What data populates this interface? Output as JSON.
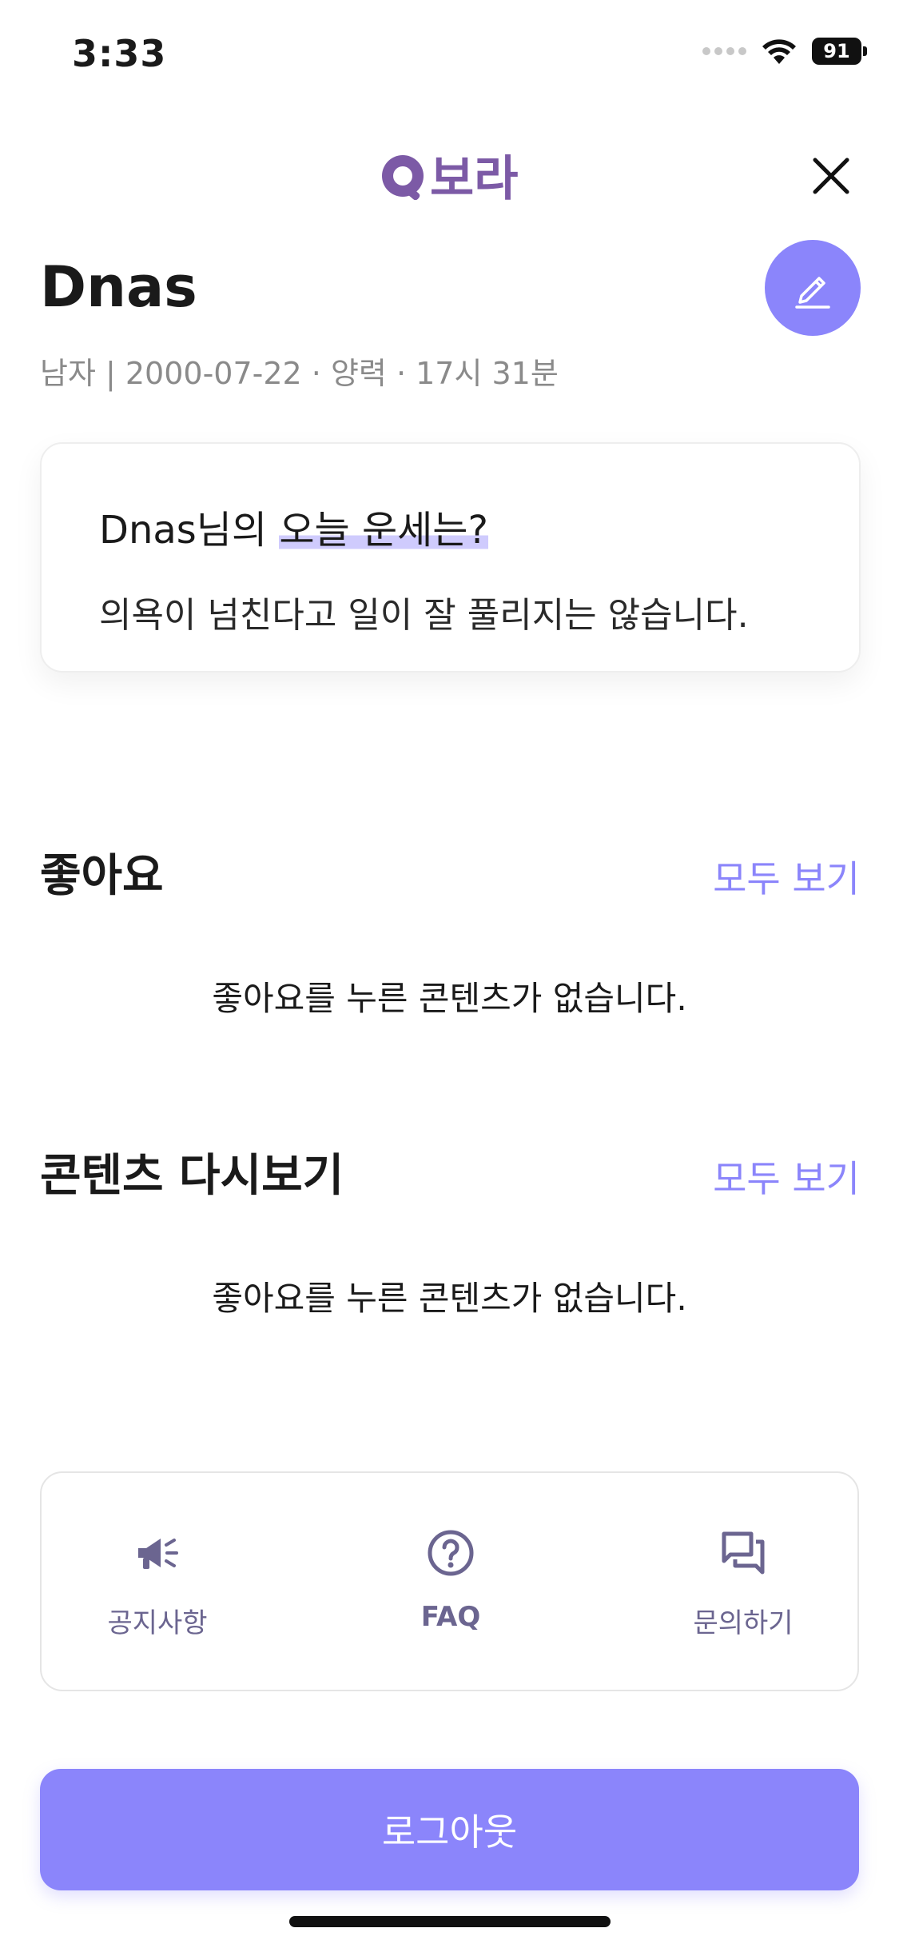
{
  "status_bar": {
    "time": "3:33",
    "battery": "91"
  },
  "header": {
    "logo_text": "보라"
  },
  "profile": {
    "name": "Dnas",
    "info": "남자 | 2000-07-22 · 양력 · 17시 31분"
  },
  "fortune": {
    "title_prefix": "Dnas님의 ",
    "title_highlight": "오늘 운세는?",
    "text": "의욕이 넘친다고 일이 잘 풀리지는 않습니다."
  },
  "likes": {
    "title": "좋아요",
    "see_all": "모두 보기",
    "empty": "좋아요를 누른 콘텐츠가 없습니다."
  },
  "replay": {
    "title": "콘텐츠 다시보기",
    "see_all": "모두 보기",
    "empty": "좋아요를 누른 콘텐츠가 없습니다."
  },
  "menu": {
    "items": [
      {
        "label": "공지사항",
        "icon": "megaphone-icon"
      },
      {
        "label": "FAQ",
        "icon": "question-circle-icon"
      },
      {
        "label": "문의하기",
        "icon": "chat-bubbles-icon"
      }
    ]
  },
  "logout_label": "로그아웃",
  "colors": {
    "accent": "#8b85fb",
    "logo": "#7c5aa6",
    "menu_icon": "#6b6590"
  }
}
